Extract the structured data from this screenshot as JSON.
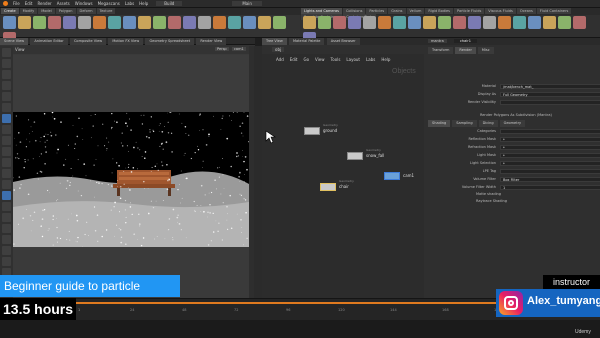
{
  "menubar": {
    "items": [
      "File",
      "Edit",
      "Render",
      "Assets",
      "Windows",
      "Megascans",
      "Labs",
      "Help"
    ],
    "desktop": "Build",
    "main_label": "Main"
  },
  "shelf": {
    "left_tabs": [
      "Create",
      "Modify",
      "Model",
      "Polygon",
      "Deform",
      "Texture",
      "Rigging",
      "Characters",
      "Constraints",
      "Hair Utils",
      "Guide Process"
    ],
    "right_tabs": [
      "Lights and Cameras",
      "Collisions",
      "Particles",
      "Grains",
      "Vellum",
      "Rigid Bodies",
      "Particle Fluids",
      "Viscous Fluids",
      "Oceans",
      "Fluid Containers",
      "Populate Containers",
      "Container Tools",
      "Pyro FX",
      "Sparse Pyro FX",
      "FEM",
      "Wires",
      "Crowds",
      "Drive Simulation"
    ]
  },
  "viewport_pane": {
    "tabs": [
      "Scene View",
      "Animation Editor",
      "Composite View",
      "Motion FX View",
      "Geometry Spreadsheet",
      "Render View"
    ],
    "view_label": "View",
    "persp_label": "Persp",
    "cam_label": "cam1",
    "bottom_hint": "Left mouse tumbles. Middle pans. Right dollies. Ctrl+Alt+Left box-zooms. Ctrl+Right for options."
  },
  "network_pane": {
    "tabs": [
      "Tree View",
      "Material Palette",
      "Asset Browser"
    ],
    "path": "obj",
    "menu": [
      "Add",
      "Edit",
      "Go",
      "View",
      "Tools",
      "Layout",
      "Labs",
      "Help"
    ],
    "context_label": "Objects",
    "nodes": [
      {
        "name": "ground",
        "sub": "Geometry",
        "color": "#c9c9c9"
      },
      {
        "name": "snow_fall",
        "sub": "Geometry",
        "color": "#c9c9c9"
      },
      {
        "name": "cam1",
        "sub": "",
        "color": "#6aa0d8"
      },
      {
        "name": "chair",
        "sub": "Geometry",
        "color": "#d6c27a"
      }
    ]
  },
  "parameter_pane": {
    "path": "mantra",
    "node_name": "chair1",
    "tabs": [
      "Transform",
      "Render",
      "Misc"
    ],
    "subtabs": [
      "Shading",
      "Sampling",
      "Dicing",
      "Geometry"
    ],
    "top_rows": [
      {
        "label": "Material",
        "value": "/mat/bench_mat_"
      },
      {
        "label": "Display As",
        "value": "Full Geometry"
      },
      {
        "label": "Render Visibility",
        "value": ""
      }
    ],
    "checkbox_label": "Render Polygons As Subdivision (Mantra)",
    "rows": [
      {
        "label": "Categories",
        "value": ""
      },
      {
        "label": "Reflection Mask",
        "value": "*"
      },
      {
        "label": "Refraction Mask",
        "value": "*"
      },
      {
        "label": "Light Mask",
        "value": "*"
      },
      {
        "label": "Light Selection",
        "value": "*"
      },
      {
        "label": "LPE Tag",
        "value": ""
      },
      {
        "label": "Volume Filter",
        "value": "Box Filter"
      },
      {
        "label": "Volume Filter Width",
        "value": "1"
      }
    ],
    "checks": [
      "Matte shading",
      "Raytrace Shading"
    ]
  },
  "timeline": {
    "frame": "1",
    "end": "240",
    "ticks": [
      "24",
      "48",
      "72",
      "96",
      "120",
      "144",
      "168",
      "192",
      "216"
    ]
  },
  "overlay": {
    "course_title": "Beginner guide to particle system",
    "duration": "13.5 hours",
    "instructor_label": "instructor",
    "instructor_handle": "Alex_tumyang",
    "watermark": "Udemy"
  },
  "colors": {
    "banner_blue": "#2196f3",
    "handle_blue": "#1565c0",
    "timeline_orange": "#e07a1f",
    "selected_node": "#3d7bd9"
  }
}
